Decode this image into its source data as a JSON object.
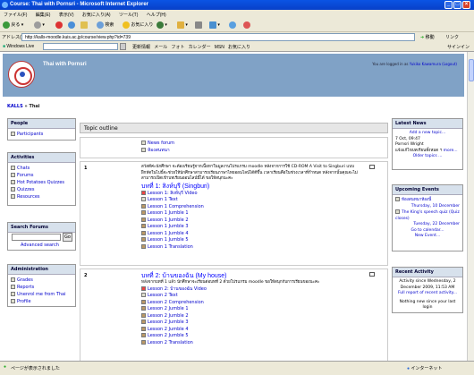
{
  "window": {
    "title": "Course: Thai with Pornsri - Microsoft Internet Explorer"
  },
  "menu": [
    "ファイル(F)",
    "編集(E)",
    "表示(V)",
    "お気に入り(A)",
    "ツール(T)",
    "ヘルプ(H)"
  ],
  "toolbar": {
    "back": "戻る",
    "search": "検索",
    "favorites": "お気に入り"
  },
  "address": {
    "label": "アドレス(D)",
    "url": "http://kalls-moodle.kuis.ac.jp/course/view.php?id=739",
    "go": "移動",
    "links": "リンク"
  },
  "live": {
    "label": "Windows Live",
    "items": [
      "更新情報",
      "メール",
      "フォト",
      "カレンダー",
      "MSN",
      "お気に入り"
    ],
    "signin": "サインイン"
  },
  "site": {
    "title": "Thai with Pornsri",
    "login_prefix": "You are logged in as",
    "login_user": "Yukiko Kawamura",
    "logout": "(Logout)"
  },
  "breadcrumb": {
    "root": "KALLS",
    "sep": " » ",
    "current": "Thai"
  },
  "people": {
    "title": "People",
    "items": [
      "Participants"
    ]
  },
  "activities": {
    "title": "Activities",
    "items": [
      "Chats",
      "Forums",
      "Hot Potatoes Quizzes",
      "Quizzes",
      "Resources"
    ]
  },
  "search": {
    "title": "Search Forums",
    "button": "Go",
    "advanced": "Advanced search"
  },
  "admin": {
    "title": "Administration",
    "items": [
      "Grades",
      "Reports",
      "Unenrol me from Thai",
      "Profile"
    ]
  },
  "topic": {
    "header": "Topic outline",
    "sec0": {
      "items": [
        "News forum",
        "ห้องสนทนา"
      ]
    },
    "sec1": {
      "num": "1",
      "intro": "สวัสดีค่ะนักศึกษา จะต้องเรียนรู้จากเนื้อหาในมูลงานโปรแกรม moodle หลังจากการใช้ CD-ROM A Visit to Singburi แบบฝึกหัดในไปนี้จะช่วยให้นักศึกษาสามารถเรียนภาษาไทยออนไลน์ได้ดีขึ้น เวลาเรียนคือในช่วงเวลาที่กำหนด หลังจากนั้นคุณจะไม่สามารถเปิดเข้าบทเรียนออนไลน์นี้ได้ ขอให้สนุกนะคะ",
      "title": "บทที่ 1: สิงห์บุรี (Singburi)",
      "items": [
        "Lesson 1: สิงห์บุรี Video",
        "Lesson 1 Text",
        "Lesson 1 Comprehension",
        "Lesson 1 Jumble 1",
        "Lesson 1 Jumble 2",
        "Lesson 1 Jumble 3",
        "Lesson 1 Jumble 4",
        "Lesson 1 Jumble 5",
        "Lesson 1 Translation"
      ]
    },
    "sec2": {
      "num": "2",
      "title": "บทที่ 2: บ้านของฉัน (My house)",
      "intro": "หลังจากบทที่ 1 แล้ว นักศึกษาจะเรียนต่อบทที่ 2 ด้วยโปรแกรม moodle ขอให้สนุกกับการเรียนของนะคะ",
      "items": [
        "Lesson 2: บ้านของฉัน Video",
        "Lesson 2 Text",
        "Lesson 2 Comprehension",
        "Lesson 2 Jumble 1",
        "Lesson 2 Jumble 2",
        "Lesson 2 Jumble 3",
        "Lesson 2 Jumble 4",
        "Lesson 2 Jumble 5",
        "Lesson 2 Translation"
      ]
    }
  },
  "news": {
    "title": "Latest News",
    "add": "Add a new topic...",
    "date": "7 Oct, 09:47",
    "author": "Pornsri Wright",
    "text": "แจ้งแก้ไขบทเรียนทั้งหมด ฯ",
    "more": "more...",
    "older": "Older topics ..."
  },
  "events": {
    "title": "Upcoming Events",
    "e1": "ห้องสนทนาห้องนี้",
    "d1": "Thursday, 10 December",
    "e2": "The King's speech quiz (Quiz closes)",
    "d2": "Tuesday, 22 December",
    "calendar": "Go to calendar...",
    "newevent": "New Event..."
  },
  "recent": {
    "title": "Recent Activity",
    "since": "Activity since Wednesday, 2 December 2009, 11:53 AM",
    "full": "Full report of recent activity...",
    "none": "Nothing new since your last login"
  },
  "status": {
    "text": "ページが表示されました",
    "zone": "インターネット"
  }
}
